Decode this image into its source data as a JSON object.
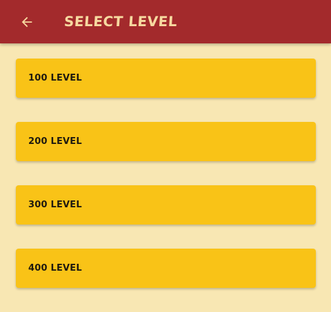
{
  "app_bar": {
    "title": "SELECT LEVEL",
    "back_icon": "arrow-left-icon",
    "background": "#a32a2c",
    "title_color": "#f7d9a0"
  },
  "levels": [
    {
      "label": "100 LEVEL"
    },
    {
      "label": "200 LEVEL"
    },
    {
      "label": "300 LEVEL"
    },
    {
      "label": "400 LEVEL"
    }
  ],
  "colors": {
    "page_background": "#f8e7b3",
    "card_background": "#f9c317",
    "card_text": "#1f1a10"
  }
}
